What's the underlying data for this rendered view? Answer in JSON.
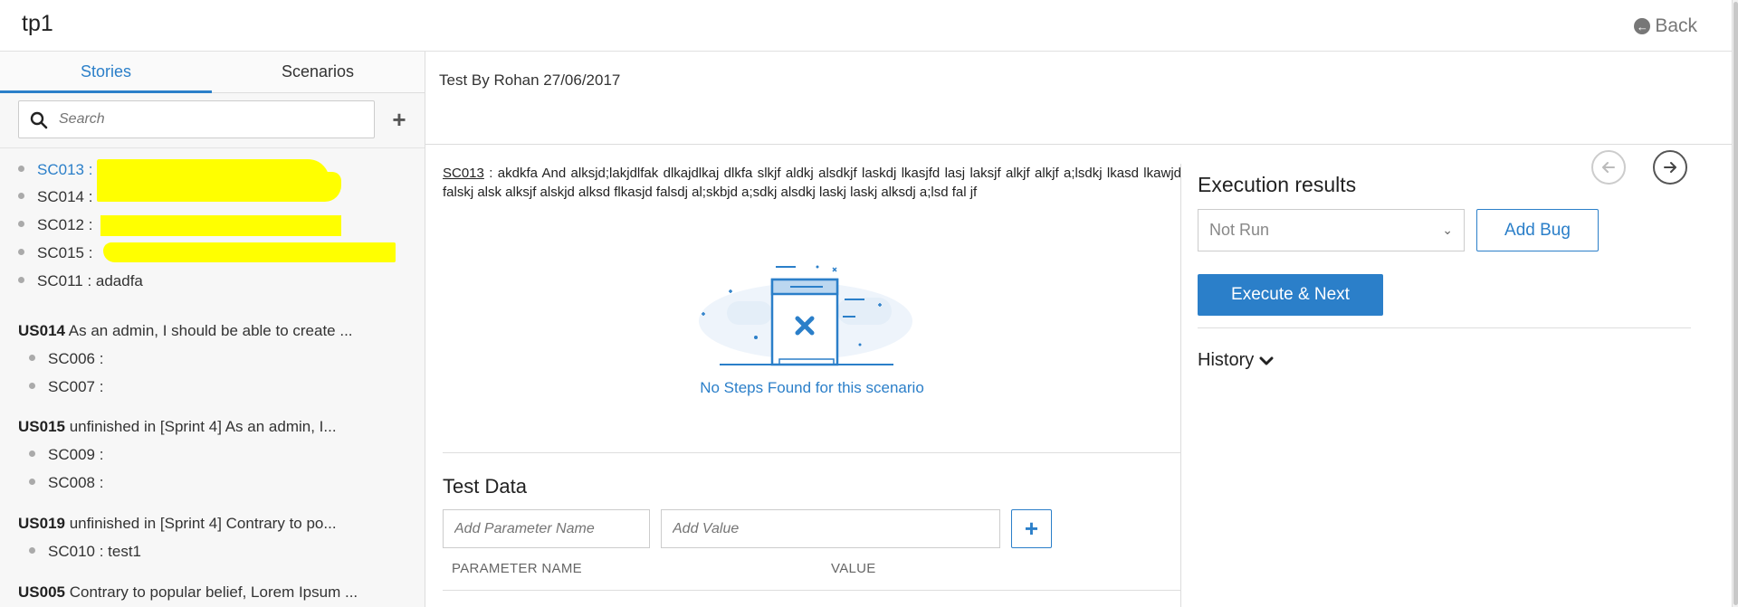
{
  "app": {
    "title": "tp1",
    "back_label": "Back"
  },
  "sidebar": {
    "tabs": [
      {
        "label": "Stories",
        "active": true
      },
      {
        "label": "Scenarios",
        "active": false
      }
    ],
    "search_placeholder": "Search",
    "add_icon": "plus-icon",
    "scenarios_top": [
      {
        "label": "SC013 :",
        "active": true
      },
      {
        "label": "SC014 :",
        "active": false
      },
      {
        "label": "SC012 :",
        "active": false
      },
      {
        "label": "SC015 :",
        "active": false
      },
      {
        "label": "SC011 : adadfa",
        "active": false
      }
    ],
    "stories": [
      {
        "id": "US014",
        "text": "As an admin, I should be able to create ...",
        "scenarios": [
          "SC006 :",
          "SC007 :"
        ]
      },
      {
        "id": "US015",
        "text": " unfinished in [Sprint 4] As an admin, I...",
        "scenarios": [
          "SC009 :",
          "SC008 :"
        ]
      },
      {
        "id": "US019",
        "text": " unfinished in [Sprint 4] Contrary to po...",
        "scenarios": [
          "SC010 : test1"
        ]
      },
      {
        "id": "US005",
        "text": "Contrary to popular belief, Lorem Ipsum ...",
        "scenarios": []
      }
    ]
  },
  "main": {
    "story_title": "Test By Rohan 27/06/2017",
    "scenario_id": "SC013",
    "scenario_text": " : akdkfa And alksjd;lakjdlfak dlkajdlkaj dlkfa slkjf aldkj alsdkjf laskdj lkasjfd lasj laksjf alkjf alkjf a;lsdkj lkasd lkawjd falskj alsk alksjf alskjd alksd flkasjd falsdj al;skbjd a;sdkj alsdkj laskj laskj alksdj a;lsd fal jf",
    "empty_message": "No Steps Found for this scenario",
    "test_data": {
      "title": "Test Data",
      "param_name_placeholder": "Add Parameter Name",
      "value_placeholder": "Add Value",
      "columns": [
        "PARAMETER NAME",
        "VALUE"
      ]
    }
  },
  "execution": {
    "title": "Execution results",
    "status": "Not Run",
    "add_bug_label": "Add Bug",
    "execute_next_label": "Execute & Next",
    "history_label": "History"
  },
  "colors": {
    "accent": "#2b7fc9",
    "redaction": "#ffff00"
  }
}
